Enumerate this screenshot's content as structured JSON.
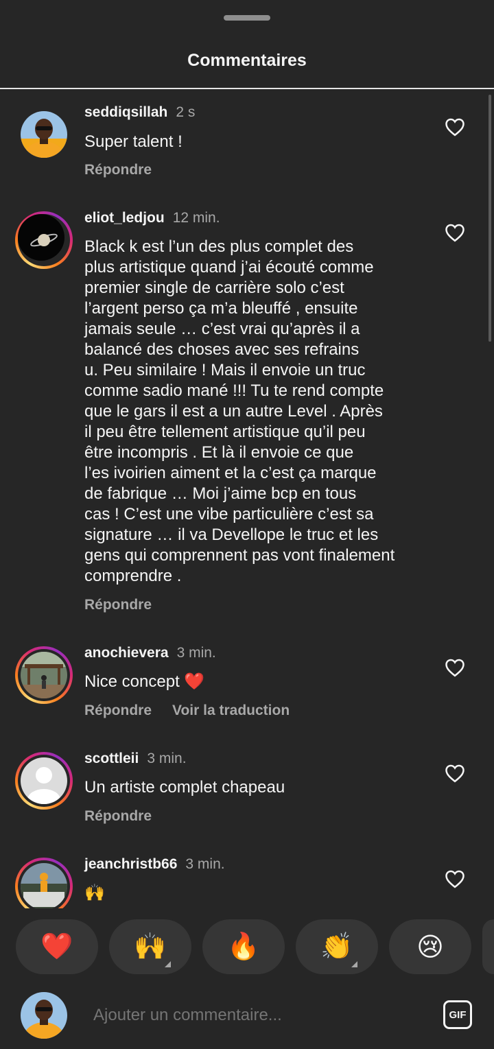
{
  "header": {
    "title": "Commentaires"
  },
  "comments": [
    {
      "user": "seddiqsillah",
      "time": "2 s",
      "text": "Super talent !",
      "reply": "Répondre"
    },
    {
      "user": "eliot_ledjou",
      "time": "12 min.",
      "text": "Black k  est l’un des plus complet des\nplus artistique quand j’ai écouté comme\npremier single de carrière solo c’est\nl’argent perso ça m’a bleuffé , ensuite\njamais seule … c’est vrai qu’après il a\nbalancé des choses avec ses refrains\nu. Peu similaire ! Mais il envoie un truc\ncomme sadio mané !!! Tu te rend compte\nque le gars il est a un autre Level . Après\nil peu être tellement artistique qu’il peu\nêtre incompris . Et là il envoie ce que\nl’es ivoirien aiment et la c’est ça marque\nde fabrique … Moi j’aime bcp en tous\ncas ! C’est une vibe particulière c’est sa\nsignature … il va Devellope le truc et les\ngens qui comprennent pas vont finalement\ncomprendre .",
      "reply": "Répondre"
    },
    {
      "user": "anochievera",
      "time": "3 min.",
      "text": "Nice concept ❤️",
      "reply": "Répondre",
      "translate": "Voir la traduction"
    },
    {
      "user": "scottleii",
      "time": "3 min.",
      "text": "Un artiste complet chapeau",
      "reply": "Répondre"
    },
    {
      "user": "jeanchristb66",
      "time": "3 min.",
      "text": "🙌"
    }
  ],
  "reactions": [
    "❤️",
    "🙌",
    "🔥",
    "👏",
    "😢"
  ],
  "composer": {
    "placeholder": "Ajouter un commentaire...",
    "gif_label": "GIF"
  },
  "colors": {
    "background": "#262626",
    "secondary_text": "#a8a8a8",
    "primary_text": "#f5f5f5",
    "pill": "#363636"
  }
}
